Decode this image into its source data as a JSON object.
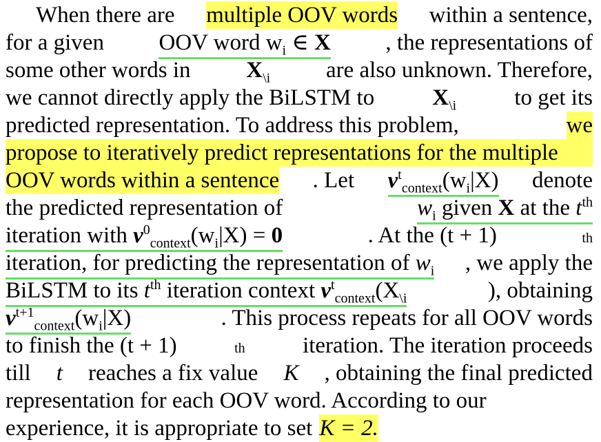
{
  "lines": [
    [
      "When there are ",
      "multiple OOV words",
      " within a sentence,"
    ],
    [
      "for a given ",
      "OOV word w",
      "i",
      " ∈ ",
      "X",
      ", the representations of"
    ],
    [
      "some other words in ",
      "X",
      "\\i",
      " are also unknown. Therefore,"
    ],
    [
      "we cannot directly apply the BiLSTM to ",
      "X",
      "\\i",
      " to get its"
    ],
    [
      "predicted representation. To address this problem, ",
      "we"
    ],
    [
      "propose to iteratively predict representations for the multiple"
    ],
    [
      "OOV words within a sentence",
      ". Let ",
      "v",
      "t",
      "context",
      "(w",
      "i",
      "|X)",
      " denote"
    ],
    [
      "the predicted representation of ",
      "w",
      "i",
      " given ",
      "X",
      " at the ",
      "t",
      "th"
    ],
    [
      "iteration with ",
      "v",
      "0",
      "context",
      "(w",
      "i",
      "|X)",
      " = ",
      "0",
      ". At the (t + 1)",
      "th"
    ],
    [
      "iteration, for predicting the representation of ",
      "w",
      "i",
      ", we apply the"
    ],
    [
      "BiLSTM to its ",
      "t",
      "th",
      " iteration context ",
      "v",
      "t",
      "context",
      "(X",
      "\\i",
      "), obtaining"
    ],
    [
      "v",
      "t+1",
      "context",
      "(w",
      "i",
      "|X)",
      ". This process repeats for all OOV words"
    ],
    [
      "to finish the (t + 1)",
      "th",
      " iteration. The iteration proceeds"
    ],
    [
      "till ",
      "t",
      " reaches a fix value ",
      "K",
      ", obtaining the final predicted"
    ],
    [
      "representation for each OOV word. According to our"
    ],
    [
      "experience, it is appropriate to set ",
      "K = 2."
    ]
  ]
}
